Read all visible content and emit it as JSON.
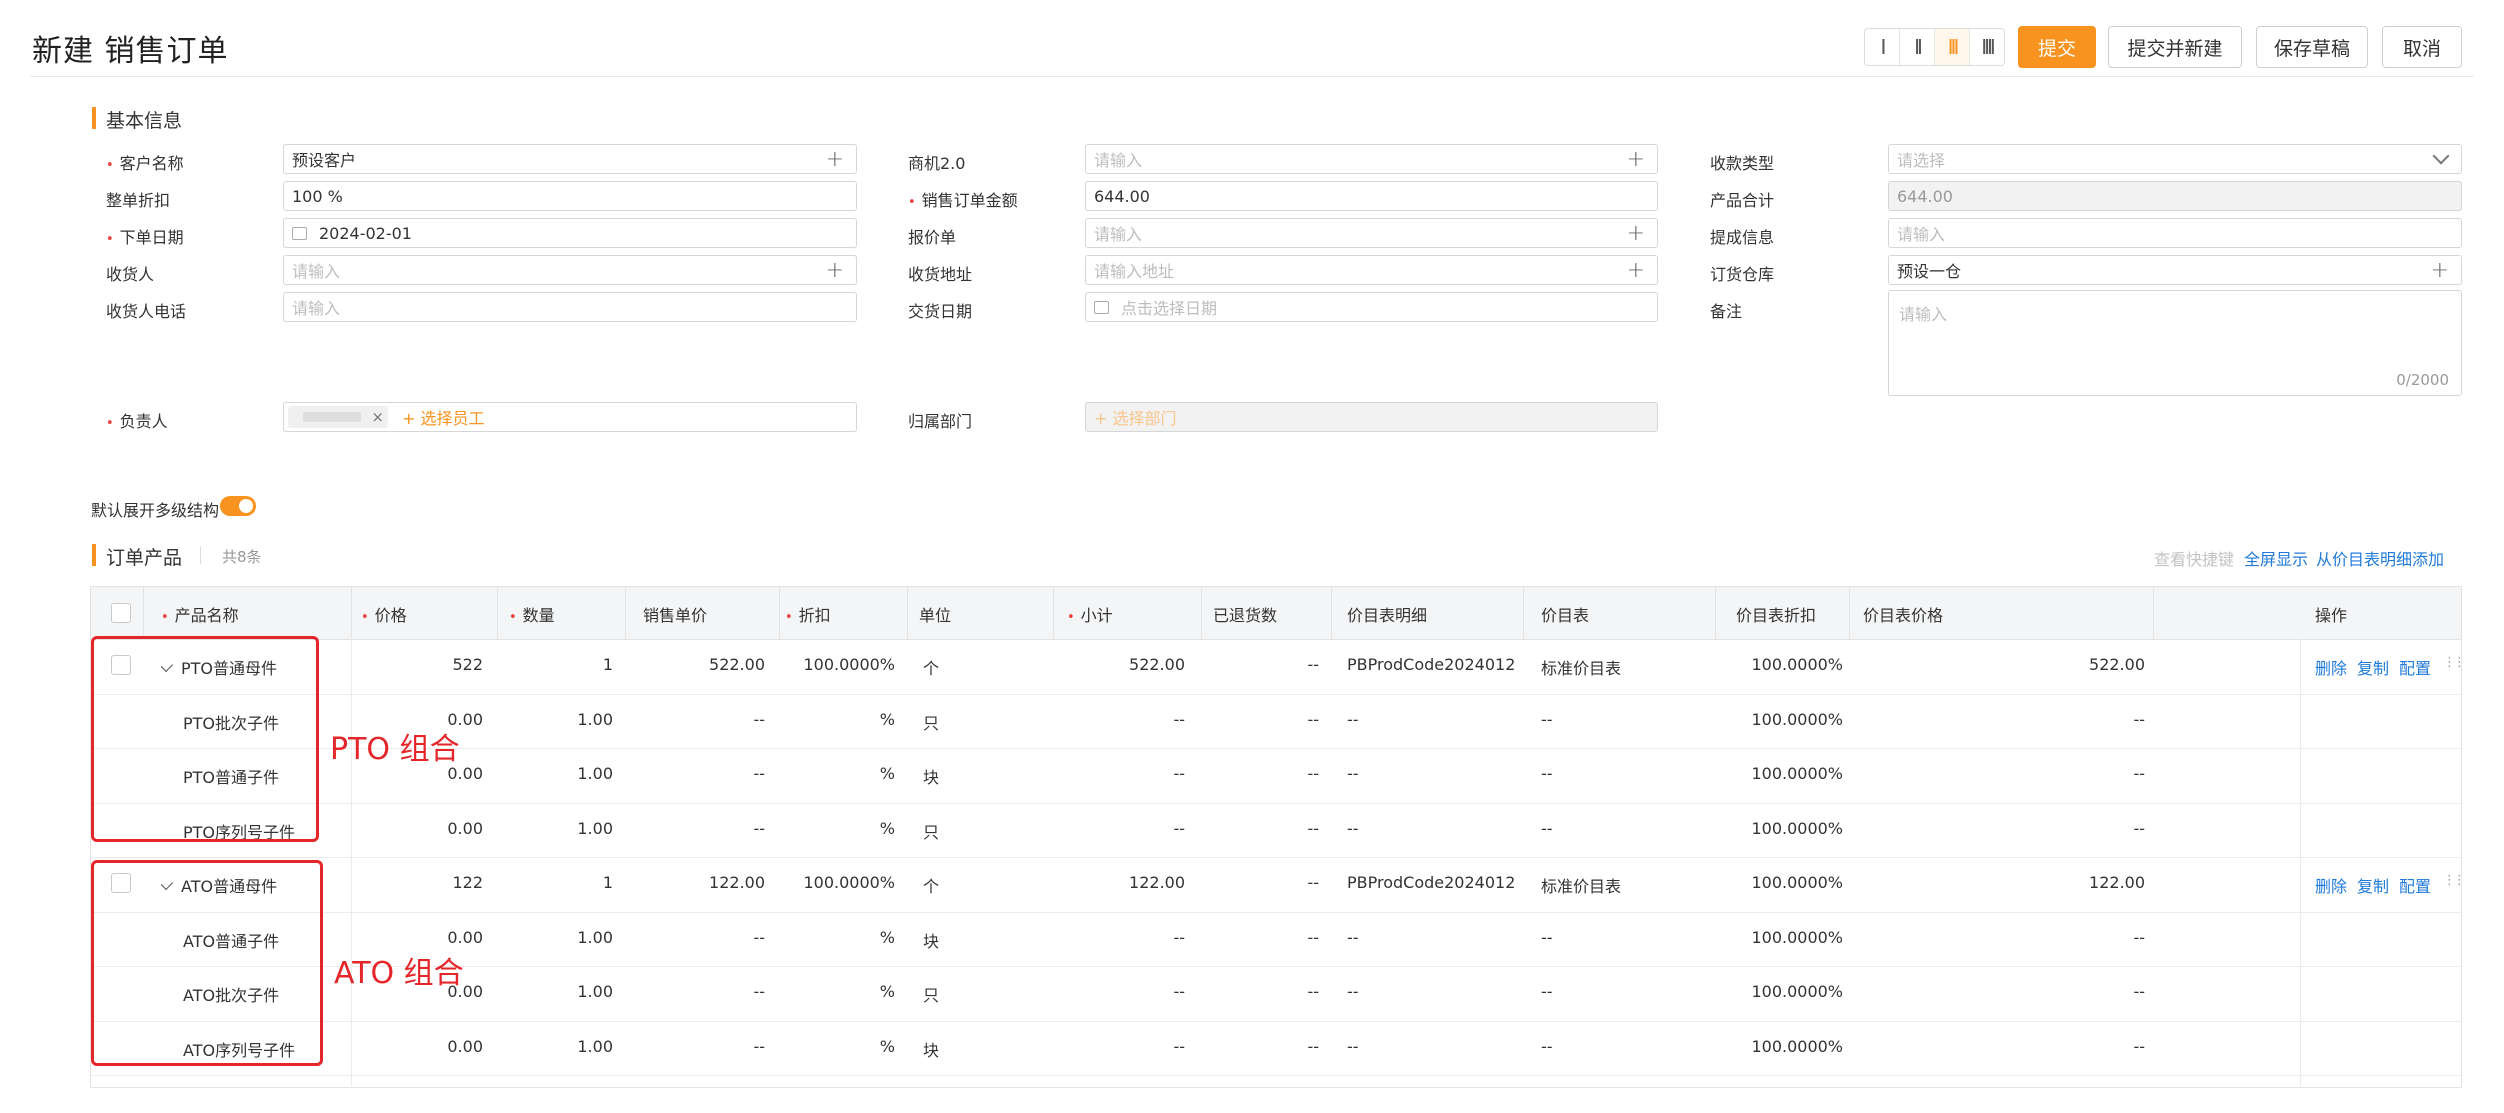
{
  "header": {
    "title": "新建 销售订单",
    "layout_columns": [
      "I",
      "II",
      "III",
      "IIII"
    ],
    "active_layout": 2,
    "buttons": {
      "submit": "提交",
      "submit_new": "提交并新建",
      "save_draft": "保存草稿",
      "cancel": "取消"
    }
  },
  "basic": {
    "title": "基本信息",
    "col1": [
      {
        "label": "客户名称",
        "required": true,
        "value": "预设客户",
        "placeholder": ""
      },
      {
        "label": "整单折扣",
        "required": false,
        "value": "100 %",
        "placeholder": ""
      },
      {
        "label": "下单日期",
        "required": true,
        "value": "2024-02-01",
        "placeholder": ""
      },
      {
        "label": "收货人",
        "required": false,
        "value": "",
        "placeholder": "请输入"
      },
      {
        "label": "收货人电话",
        "required": false,
        "value": "",
        "placeholder": "请输入"
      }
    ],
    "col2": [
      {
        "label": "商机2.0",
        "required": false,
        "value": "",
        "placeholder": "请输入"
      },
      {
        "label": "销售订单金额",
        "required": true,
        "value": "644.00",
        "placeholder": ""
      },
      {
        "label": "报价单",
        "required": false,
        "value": "",
        "placeholder": "请输入"
      },
      {
        "label": "收货地址",
        "required": false,
        "value": "",
        "placeholder": "请输入地址"
      },
      {
        "label": "交货日期",
        "required": false,
        "value": "",
        "placeholder": "点击选择日期"
      }
    ],
    "col3": [
      {
        "label": "收款类型",
        "required": false,
        "value": "",
        "placeholder": "请选择"
      },
      {
        "label": "产品合计",
        "required": false,
        "value": "644.00",
        "placeholder": ""
      },
      {
        "label": "提成信息",
        "required": false,
        "value": "",
        "placeholder": "请输入"
      },
      {
        "label": "订货仓库",
        "required": false,
        "value": "预设一仓",
        "placeholder": ""
      },
      {
        "label": "备注",
        "required": false,
        "value": "",
        "placeholder": "请输入"
      }
    ],
    "remark_counter": "0/2000",
    "owner": {
      "label": "负责人",
      "add_text": "+ 选择员工",
      "tag_close": "×"
    },
    "dept": {
      "label": "归属部门",
      "placeholder": "+ 选择部门"
    }
  },
  "toggle": {
    "label": "默认展开多级结构",
    "on": true
  },
  "products": {
    "title": "订单产品",
    "count": "共8条",
    "links": {
      "shortcut": "查看快捷键",
      "fullscreen": "全屏显示",
      "add_from_pricebook": "从价目表明细添加"
    },
    "columns": [
      {
        "label": "产品名称",
        "required": true
      },
      {
        "label": "价格",
        "required": true
      },
      {
        "label": "数量",
        "required": true
      },
      {
        "label": "销售单价",
        "required": false
      },
      {
        "label": "折扣",
        "required": true
      },
      {
        "label": "单位",
        "required": false
      },
      {
        "label": "小计",
        "required": true
      },
      {
        "label": "已退货数",
        "required": false
      },
      {
        "label": "价目表明细",
        "required": false
      },
      {
        "label": "价目表",
        "required": false
      },
      {
        "label": "价目表折扣",
        "required": false
      },
      {
        "label": "价目表价格",
        "required": false
      },
      {
        "label": "操作",
        "required": false
      }
    ],
    "rows": [
      {
        "parent": true,
        "name": "PTO普通母件",
        "price": "522",
        "qty": "1",
        "unit_price": "522.00",
        "discount": "100.0000%",
        "unit": "个",
        "subtotal": "522.00",
        "returned": "--",
        "pb_detail": "PBProdCode2024012…",
        "pricebook": "标准价目表",
        "pb_discount": "100.0000%",
        "pb_price": "522.00"
      },
      {
        "parent": false,
        "name": "PTO批次子件",
        "price": "0.00",
        "qty": "1.00",
        "unit_price": "--",
        "discount": "%",
        "unit": "只",
        "subtotal": "--",
        "returned": "--",
        "pb_detail": "--",
        "pricebook": "--",
        "pb_discount": "100.0000%",
        "pb_price": "--"
      },
      {
        "parent": false,
        "name": "PTO普通子件",
        "price": "0.00",
        "qty": "1.00",
        "unit_price": "--",
        "discount": "%",
        "unit": "块",
        "subtotal": "--",
        "returned": "--",
        "pb_detail": "--",
        "pricebook": "--",
        "pb_discount": "100.0000%",
        "pb_price": "--"
      },
      {
        "parent": false,
        "name": "PTO序列号子件",
        "price": "0.00",
        "qty": "1.00",
        "unit_price": "--",
        "discount": "%",
        "unit": "只",
        "subtotal": "--",
        "returned": "--",
        "pb_detail": "--",
        "pricebook": "--",
        "pb_discount": "100.0000%",
        "pb_price": "--"
      },
      {
        "parent": true,
        "name": "ATO普通母件",
        "price": "122",
        "qty": "1",
        "unit_price": "122.00",
        "discount": "100.0000%",
        "unit": "个",
        "subtotal": "122.00",
        "returned": "--",
        "pb_detail": "PBProdCode2024012…",
        "pricebook": "标准价目表",
        "pb_discount": "100.0000%",
        "pb_price": "122.00"
      },
      {
        "parent": false,
        "name": "ATO普通子件",
        "price": "0.00",
        "qty": "1.00",
        "unit_price": "--",
        "discount": "%",
        "unit": "块",
        "subtotal": "--",
        "returned": "--",
        "pb_detail": "--",
        "pricebook": "--",
        "pb_discount": "100.0000%",
        "pb_price": "--"
      },
      {
        "parent": false,
        "name": "ATO批次子件",
        "price": "0.00",
        "qty": "1.00",
        "unit_price": "--",
        "discount": "%",
        "unit": "只",
        "subtotal": "--",
        "returned": "--",
        "pb_detail": "--",
        "pricebook": "--",
        "pb_discount": "100.0000%",
        "pb_price": "--"
      },
      {
        "parent": false,
        "name": "ATO序列号子件",
        "price": "0.00",
        "qty": "1.00",
        "unit_price": "--",
        "discount": "%",
        "unit": "块",
        "subtotal": "--",
        "returned": "--",
        "pb_detail": "--",
        "pricebook": "--",
        "pb_discount": "100.0000%",
        "pb_price": "--"
      }
    ],
    "actions": [
      "删除",
      "复制",
      "配置"
    ]
  },
  "annotations": [
    "PTO 组合",
    "ATO 组合"
  ],
  "colors": {
    "accent": "#f7931e",
    "link": "#1f7ad8",
    "annotation": "#e4262a",
    "required": "#e8413c"
  }
}
